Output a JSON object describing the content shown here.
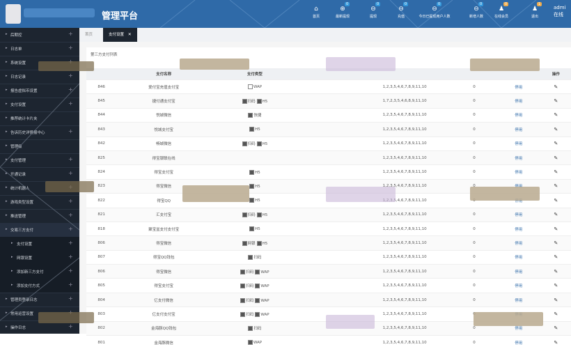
{
  "header": {
    "brand": "管理平台",
    "nav": [
      {
        "icon": "home-icon",
        "glyph": "⌂",
        "label": "首页",
        "badge": ""
      },
      {
        "icon": "plus-circle-icon",
        "glyph": "⊕",
        "label": "最新提现",
        "badge": "0"
      },
      {
        "icon": "minus-circle-icon",
        "glyph": "⊖",
        "label": "提现",
        "badge": "0"
      },
      {
        "icon": "minus-circle-icon",
        "glyph": "⊖",
        "label": "充值",
        "badge": "0"
      },
      {
        "icon": "minus-circle-icon",
        "glyph": "⊖",
        "label": "今日已提现用户人数",
        "badge": "0"
      },
      {
        "icon": "minus-circle-icon",
        "glyph": "⊖",
        "label": "新增人数",
        "badge": "0"
      },
      {
        "icon": "user-icon",
        "glyph": "♟",
        "label": "在线会员",
        "badge": "0"
      },
      {
        "icon": "user-icon",
        "glyph": "♟",
        "label": "退出",
        "badge": "1"
      }
    ],
    "admin_label": "admi",
    "admin_sub": "在线"
  },
  "sidebar": {
    "items": [
      {
        "label": "后期控",
        "plus": "+"
      },
      {
        "label": "日志单",
        "plus": "+"
      },
      {
        "label": "系统设置",
        "plus": "+"
      },
      {
        "label": "日志记录",
        "plus": "+"
      },
      {
        "label": "报告虚拟币设置",
        "plus": "+"
      },
      {
        "label": "支付设置",
        "plus": "+"
      },
      {
        "label": "推荐统计卡片夹",
        "plus": ""
      },
      {
        "label": "告诉历史详情报中心",
        "plus": "+"
      },
      {
        "label": "管理级",
        "plus": ""
      },
      {
        "label": "支付管理",
        "plus": "+"
      },
      {
        "label": "开通记录",
        "plus": "+"
      },
      {
        "label": "统计机器人",
        "plus": "+"
      },
      {
        "label": "游戏类型设置",
        "plus": "+"
      },
      {
        "label": "推送管理",
        "plus": "+"
      },
      {
        "label": "交易三方支付",
        "plus": "+"
      },
      {
        "label": "支付设置",
        "plus": "+"
      },
      {
        "label": "网银设置",
        "plus": "+"
      },
      {
        "label": "添加新三方支付",
        "plus": "+"
      },
      {
        "label": "添加支付方式",
        "plus": "+"
      },
      {
        "label": "管理员登录日志",
        "plus": "+"
      },
      {
        "label": "常用运营设置",
        "plus": "+"
      },
      {
        "label": "操作日志",
        "plus": "+"
      }
    ]
  },
  "tabs": [
    {
      "label": "首页",
      "close": ""
    },
    {
      "label": "支付设置",
      "close": "✕"
    }
  ],
  "panel_title": "第三方支付列表",
  "table": {
    "headers": [
      "",
      "支付名称",
      "支付类型",
      "",
      "",
      "",
      "操作"
    ],
    "action_label": "停用",
    "rows": [
      {
        "id": "846",
        "name": "爱付宝充值支付宝",
        "types": [
          {
            "on": false,
            "t": "WAP"
          }
        ],
        "days": "1,2,3,5,4,6,7,8,9,11,10",
        "n": "0"
      },
      {
        "id": "845",
        "name": "捷付通支付宝",
        "types": [
          {
            "on": true,
            "t": "扫码"
          },
          {
            "on": true,
            "t": "H5"
          }
        ],
        "days": "1,7,2,3,5,4,6,8,9,11,10",
        "n": "0"
      },
      {
        "id": "844",
        "name": "悦城微信",
        "types": [
          {
            "on": true,
            "t": "快捷"
          }
        ],
        "days": "1,2,3,5,4,6,7,8,9,11,10",
        "n": "0"
      },
      {
        "id": "843",
        "name": "悦城支付宝",
        "types": [
          {
            "on": true,
            "t": "H5"
          }
        ],
        "days": "1,2,3,5,4,6,7,8,9,11,10",
        "n": "0"
      },
      {
        "id": "842",
        "name": "畅城微信",
        "types": [
          {
            "on": true,
            "t": "扫码"
          },
          {
            "on": true,
            "t": "H5"
          }
        ],
        "days": "1,2,3,5,4,6,7,8,9,11,10",
        "n": "0"
      },
      {
        "id": "825",
        "name": "得宝银联在线",
        "types": [],
        "days": "1,2,3,5,4,6,7,8,9,11,10",
        "n": "0"
      },
      {
        "id": "824",
        "name": "得宝支付宝",
        "types": [
          {
            "on": true,
            "t": "H5"
          }
        ],
        "days": "1,2,3,5,4,6,7,8,9,11,10",
        "n": "0"
      },
      {
        "id": "823",
        "name": "得宝微信",
        "types": [
          {
            "on": true,
            "t": "H5"
          }
        ],
        "days": "1,2,3,5,4,6,7,8,9,11,10",
        "n": "0"
      },
      {
        "id": "822",
        "name": "得宝QQ",
        "types": [
          {
            "on": true,
            "t": "H5"
          }
        ],
        "days": "1,2,3,5,4,6,7,8,9,11,10",
        "n": "0"
      },
      {
        "id": "821",
        "name": "汇支付宝",
        "types": [
          {
            "on": true,
            "t": "扫码"
          },
          {
            "on": true,
            "t": "H5"
          }
        ],
        "days": "1,2,3,5,4,6,7,8,9,11,10",
        "n": "0"
      },
      {
        "id": "818",
        "name": "聚宝盆支付支付宝",
        "types": [
          {
            "on": true,
            "t": "H5"
          }
        ],
        "days": "1,2,3,5,4,6,7,8,9,11,10",
        "n": "0"
      },
      {
        "id": "806",
        "name": "得宝微信",
        "types": [
          {
            "on": true,
            "t": "网银"
          },
          {
            "on": true,
            "t": "H5"
          }
        ],
        "days": "1,2,3,5,4,6,7,8,9,11,10",
        "n": "0"
      },
      {
        "id": "807",
        "name": "得宝QQ钱包",
        "types": [
          {
            "on": true,
            "t": "扫码"
          }
        ],
        "days": "1,2,3,5,4,6,7,8,9,11,10",
        "n": "0"
      },
      {
        "id": "806",
        "name": "得宝微信",
        "types": [
          {
            "on": true,
            "t": "扫码"
          },
          {
            "on": true,
            "t": "WAP"
          }
        ],
        "days": "1,2,3,5,4,6,7,8,9,11,10",
        "n": "0"
      },
      {
        "id": "805",
        "name": "得宝支付宝",
        "types": [
          {
            "on": true,
            "t": "扫码"
          },
          {
            "on": true,
            "t": "WAP"
          }
        ],
        "days": "1,2,3,5,4,6,7,8,9,11,10",
        "n": "0"
      },
      {
        "id": "804",
        "name": "亿支付微信",
        "types": [
          {
            "on": true,
            "t": "扫码"
          },
          {
            "on": true,
            "t": "WAP"
          }
        ],
        "days": "1,2,3,5,4,6,7,8,9,11,10",
        "n": "0"
      },
      {
        "id": "803",
        "name": "亿支付支付宝",
        "types": [
          {
            "on": true,
            "t": "扫码"
          },
          {
            "on": true,
            "t": "WAP"
          }
        ],
        "days": "1,2,3,5,4,6,7,8,9,11,10",
        "n": "0"
      },
      {
        "id": "802",
        "name": "金海豚QQ钱包",
        "types": [
          {
            "on": true,
            "t": "扫码"
          }
        ],
        "days": "1,2,3,5,4,6,7,8,9,11,10",
        "n": "0"
      },
      {
        "id": "801",
        "name": "金海豚微信",
        "types": [
          {
            "on": true,
            "t": "WAP"
          }
        ],
        "days": "1,2,3,5,4,6,7,8,9,11,10",
        "n": "0"
      }
    ]
  }
}
